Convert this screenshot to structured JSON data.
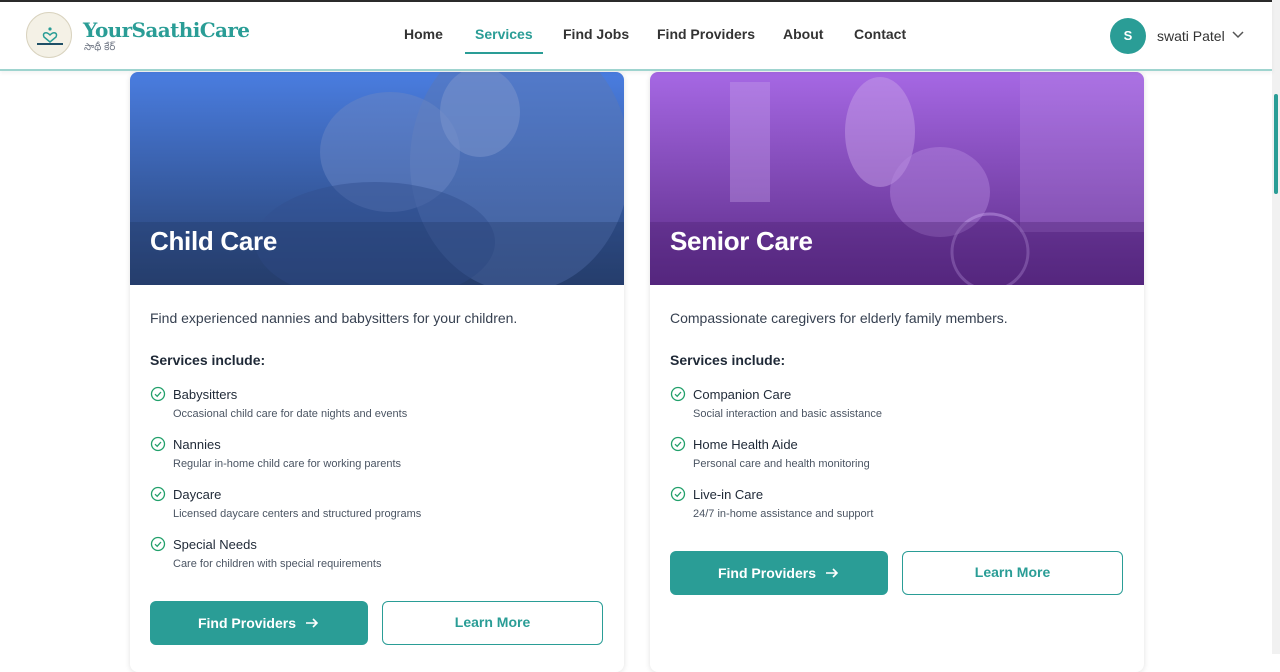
{
  "header": {
    "brand_name": "YourSaathiCare",
    "brand_sub": "సాథీ కేర్",
    "logo_text": "SAATHI CARE",
    "nav": [
      "Home",
      "Services",
      "Find Jobs",
      "Find Providers",
      "About",
      "Contact"
    ],
    "active_nav": "Services",
    "user_initial": "S",
    "user_name": "swati Patel"
  },
  "cards": [
    {
      "title": "Child Care",
      "description": "Find experienced nannies and babysitters for your children.",
      "services_heading": "Services include:",
      "services": [
        {
          "name": "Babysitters",
          "desc": "Occasional child care for date nights and events"
        },
        {
          "name": "Nannies",
          "desc": "Regular in-home child care for working parents"
        },
        {
          "name": "Daycare",
          "desc": "Licensed daycare centers and structured programs"
        },
        {
          "name": "Special Needs",
          "desc": "Care for children with special requirements"
        }
      ],
      "primary_btn": "Find Providers",
      "secondary_btn": "Learn More",
      "hero_color": "#3f6fd1"
    },
    {
      "title": "Senior Care",
      "description": "Compassionate caregivers for elderly family members.",
      "services_heading": "Services include:",
      "services": [
        {
          "name": "Companion Care",
          "desc": "Social interaction and basic assistance"
        },
        {
          "name": "Home Health Aide",
          "desc": "Personal care and health monitoring"
        },
        {
          "name": "Live-in Care",
          "desc": "24/7 in-home assistance and support"
        }
      ],
      "primary_btn": "Find Providers",
      "secondary_btn": "Learn More",
      "hero_color": "#8e44c9"
    }
  ],
  "colors": {
    "accent": "#2a9d96",
    "check": "#22a06b"
  }
}
